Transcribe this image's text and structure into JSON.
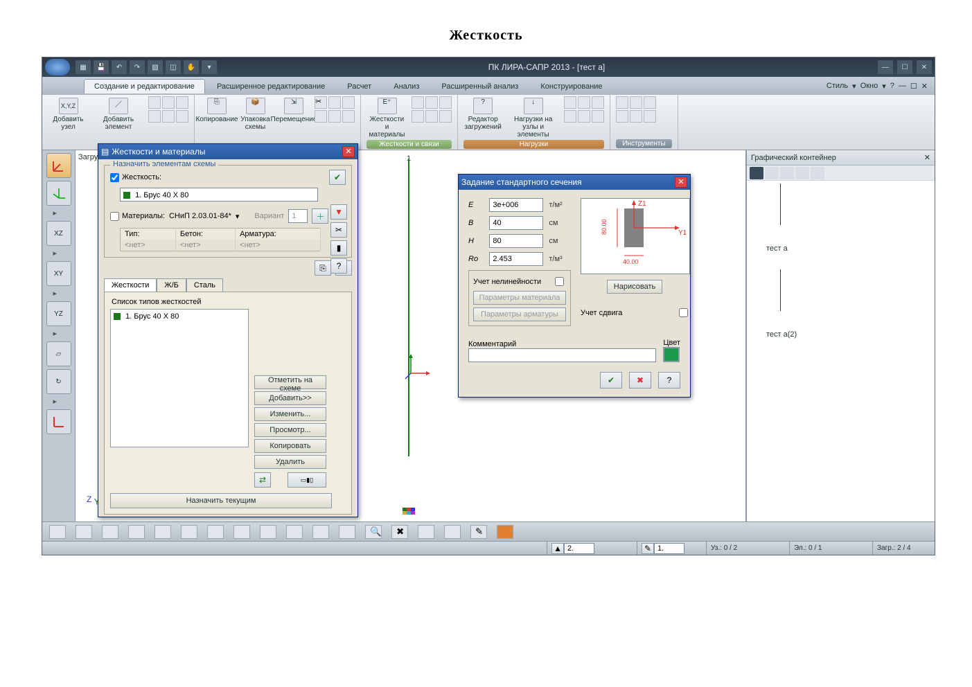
{
  "doc_title": "Жесткость",
  "titlebar": {
    "app_title": "ПК ЛИРА-САПР  2013 - [тест а]"
  },
  "tabs": {
    "items": [
      "Создание и редактирование",
      "Расширенное редактирование",
      "Расчет",
      "Анализ",
      "Расширенный анализ",
      "Конструирование"
    ],
    "active_index": 0,
    "right_style": "Стиль",
    "right_window": "Окно"
  },
  "ribbon": {
    "coord_label": "X,Y,Z",
    "add_node": "Добавить узел",
    "add_element": "Добавить элемент",
    "copy": "Копирование",
    "pack": "Упаковка схемы",
    "move": "Перемещение",
    "stiff_mat": "Жесткости и материалы",
    "stiff_group": "Жесткости и связи",
    "load_editor": "Редактор загружений",
    "loads_nodes": "Нагрузки на узлы и элементы",
    "loads_group": "Нагрузки",
    "tools_group": "Инструменты"
  },
  "left_tools": [
    "",
    "XZ",
    "XY",
    "YZ",
    "",
    "",
    ""
  ],
  "canvas": {
    "loadings_label": "Загруж",
    "axis_label": "1",
    "zy": "Z Y"
  },
  "right_panel": {
    "title": "Графический контейнер",
    "item1": "тест а",
    "item2": "тест а(2)"
  },
  "statusbar": {
    "spin1": "2.",
    "spin2": "1.",
    "uz": "Уз.: 0 / 2",
    "el": "Эл.: 0 / 1",
    "zagr": "Загр.: 2 / 4"
  },
  "dialog1": {
    "title": "Жесткости и материалы",
    "legend": "Назначить элементам схемы",
    "chk_stiff": "Жесткость:",
    "stiff_value": "1. Брус 40 X 80",
    "chk_mat": "Материалы:",
    "mat_mode": "СНиП 2.03.01-84*",
    "variant_label": "Вариант",
    "variant_val": "1",
    "col_type": "Тип:",
    "col_concrete": "Бетон:",
    "col_rebar": "Арматура:",
    "none": "<нет>",
    "tabs": [
      "Жесткости",
      "Ж/Б",
      "Сталь"
    ],
    "list_label": "Список типов жесткостей",
    "list_item": "1. Брус 40 X 80",
    "btn_mark": "Отметить на схеме",
    "btn_add": "Добавить>>",
    "btn_edit": "Изменить...",
    "btn_view": "Просмотр...",
    "btn_copy": "Копировать",
    "btn_del": "Удалить",
    "btn_assign": "Назначить текущим"
  },
  "dialog2": {
    "title": "Задание стандартного сечения",
    "p_E": "E",
    "v_E": "3e+006",
    "u_E": "т/м²",
    "p_B": "B",
    "v_B": "40",
    "u_B": "см",
    "p_H": "H",
    "v_H": "80",
    "u_H": "см",
    "p_Ro": "Ro",
    "v_Ro": "2.453",
    "u_Ro": "т/м³",
    "chk_nonlin": "Учет нелинейности",
    "btn_matparams": "Параметры материала",
    "btn_rebarparams": "Параметры арматуры",
    "chk_shear": "Учет сдвига",
    "btn_draw": "Нарисовать",
    "lbl_z1": "Z1",
    "lbl_y1": "Y1",
    "dim_h": "80.00",
    "dim_w": "40.00",
    "comment_label": "Комментарий",
    "color_label": "Цвет"
  }
}
